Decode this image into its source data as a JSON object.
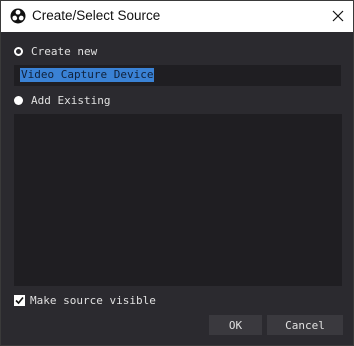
{
  "window": {
    "title": "Create/Select Source",
    "logo_icon": "obs-logo-icon",
    "close_icon": "close-icon"
  },
  "options": {
    "create_new": {
      "label": "Create new",
      "selected": true
    },
    "name_value": "Video Capture Device",
    "add_existing": {
      "label": "Add Existing",
      "selected": false
    },
    "existing_items": []
  },
  "visible_checkbox": {
    "label": "Make source visible",
    "checked": true
  },
  "buttons": {
    "ok": "OK",
    "cancel": "Cancel"
  },
  "colors": {
    "background": "#2b2a2f",
    "field": "#1f1e22",
    "selection": "#3a82d5",
    "button": "#3a393e",
    "text": "#e0e0e0"
  }
}
